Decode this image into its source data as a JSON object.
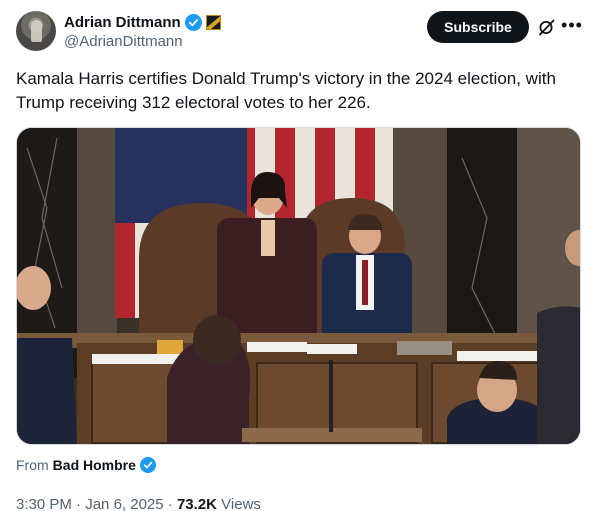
{
  "author": {
    "display_name": "Adrian Dittmann",
    "handle": "@AdrianDittmann",
    "verified_badge": "verified-badge-icon",
    "affiliate_badge": "affiliate-badge-icon"
  },
  "actions": {
    "subscribe_label": "Subscribe",
    "more_icon": "•••"
  },
  "tweet": {
    "text": "Kamala Harris certifies Donald Trump's victory in the 2024 election, with Trump receiving 312 electoral votes to her 226."
  },
  "attribution": {
    "prefix": "From",
    "source": "Bad Hombre"
  },
  "meta": {
    "time": "3:30 PM",
    "separator1": "·",
    "date": "Jan 6, 2025",
    "separator2": "·",
    "views_count": "73.2K",
    "views_label": "Views"
  },
  "colors": {
    "accent": "#1d9bf0",
    "text_primary": "#0f1419",
    "text_secondary": "#536471"
  }
}
